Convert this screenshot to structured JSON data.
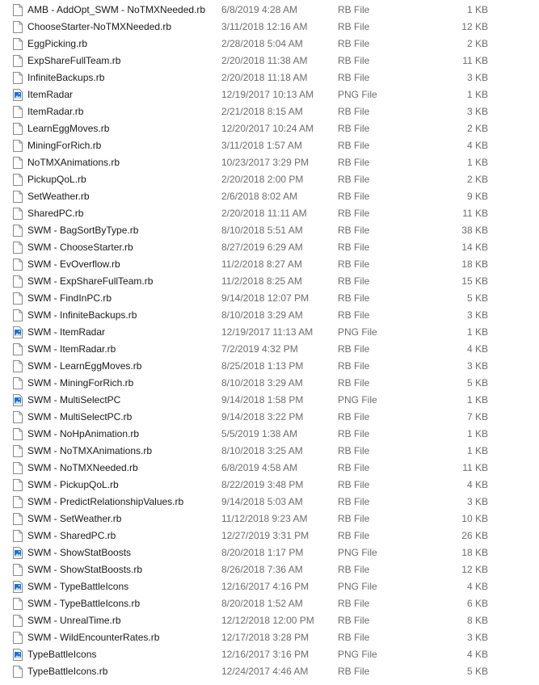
{
  "files": [
    {
      "name": "AMB - AddOpt_SWM - NoTMXNeeded.rb",
      "date": "6/8/2019 4:28 AM",
      "type": "RB File",
      "size": "1 KB",
      "icon": "document-icon"
    },
    {
      "name": "ChooseStarter-NoTMXNeeded.rb",
      "date": "3/11/2018 12:16 AM",
      "type": "RB File",
      "size": "12 KB",
      "icon": "document-icon"
    },
    {
      "name": "EggPicking.rb",
      "date": "2/28/2018 5:04 AM",
      "type": "RB File",
      "size": "2 KB",
      "icon": "document-icon"
    },
    {
      "name": "ExpShareFullTeam.rb",
      "date": "2/20/2018 11:38 AM",
      "type": "RB File",
      "size": "11 KB",
      "icon": "document-icon"
    },
    {
      "name": "InfiniteBackups.rb",
      "date": "2/20/2018 11:18 AM",
      "type": "RB File",
      "size": "3 KB",
      "icon": "document-icon"
    },
    {
      "name": "ItemRadar",
      "date": "12/19/2017 10:13 AM",
      "type": "PNG File",
      "size": "1 KB",
      "icon": "image-icon"
    },
    {
      "name": "ItemRadar.rb",
      "date": "2/21/2018 8:15 AM",
      "type": "RB File",
      "size": "3 KB",
      "icon": "document-icon"
    },
    {
      "name": "LearnEggMoves.rb",
      "date": "12/20/2017 10:24 AM",
      "type": "RB File",
      "size": "2 KB",
      "icon": "document-icon"
    },
    {
      "name": "MiningForRich.rb",
      "date": "3/11/2018 1:57 AM",
      "type": "RB File",
      "size": "4 KB",
      "icon": "document-icon"
    },
    {
      "name": "NoTMXAnimations.rb",
      "date": "10/23/2017 3:29 PM",
      "type": "RB File",
      "size": "1 KB",
      "icon": "document-icon"
    },
    {
      "name": "PickupQoL.rb",
      "date": "2/20/2018 2:00 PM",
      "type": "RB File",
      "size": "2 KB",
      "icon": "document-icon"
    },
    {
      "name": "SetWeather.rb",
      "date": "2/6/2018 8:02 AM",
      "type": "RB File",
      "size": "9 KB",
      "icon": "document-icon"
    },
    {
      "name": "SharedPC.rb",
      "date": "2/20/2018 11:11 AM",
      "type": "RB File",
      "size": "11 KB",
      "icon": "document-icon"
    },
    {
      "name": "SWM - BagSortByType.rb",
      "date": "8/10/2018 5:51 AM",
      "type": "RB File",
      "size": "38 KB",
      "icon": "document-icon"
    },
    {
      "name": "SWM - ChooseStarter.rb",
      "date": "8/27/2019 6:29 AM",
      "type": "RB File",
      "size": "14 KB",
      "icon": "document-icon"
    },
    {
      "name": "SWM - EvOverflow.rb",
      "date": "11/2/2018 8:27 AM",
      "type": "RB File",
      "size": "18 KB",
      "icon": "document-icon"
    },
    {
      "name": "SWM - ExpShareFullTeam.rb",
      "date": "11/2/2018 8:25 AM",
      "type": "RB File",
      "size": "15 KB",
      "icon": "document-icon"
    },
    {
      "name": "SWM - FindInPC.rb",
      "date": "9/14/2018 12:07 PM",
      "type": "RB File",
      "size": "5 KB",
      "icon": "document-icon"
    },
    {
      "name": "SWM - InfiniteBackups.rb",
      "date": "8/10/2018 3:29 AM",
      "type": "RB File",
      "size": "3 KB",
      "icon": "document-icon"
    },
    {
      "name": "SWM - ItemRadar",
      "date": "12/19/2017 11:13 AM",
      "type": "PNG File",
      "size": "1 KB",
      "icon": "image-icon"
    },
    {
      "name": "SWM - ItemRadar.rb",
      "date": "7/2/2019 4:32 PM",
      "type": "RB File",
      "size": "4 KB",
      "icon": "document-icon"
    },
    {
      "name": "SWM - LearnEggMoves.rb",
      "date": "8/25/2018 1:13 PM",
      "type": "RB File",
      "size": "3 KB",
      "icon": "document-icon"
    },
    {
      "name": "SWM - MiningForRich.rb",
      "date": "8/10/2018 3:29 AM",
      "type": "RB File",
      "size": "5 KB",
      "icon": "document-icon"
    },
    {
      "name": "SWM - MultiSelectPC",
      "date": "9/14/2018 1:58 PM",
      "type": "PNG File",
      "size": "1 KB",
      "icon": "image-icon"
    },
    {
      "name": "SWM - MultiSelectPC.rb",
      "date": "9/14/2018 3:22 PM",
      "type": "RB File",
      "size": "7 KB",
      "icon": "document-icon"
    },
    {
      "name": "SWM - NoHpAnimation.rb",
      "date": "5/5/2019 1:38 AM",
      "type": "RB File",
      "size": "1 KB",
      "icon": "document-icon"
    },
    {
      "name": "SWM - NoTMXAnimations.rb",
      "date": "8/10/2018 3:25 AM",
      "type": "RB File",
      "size": "1 KB",
      "icon": "document-icon"
    },
    {
      "name": "SWM - NoTMXNeeded.rb",
      "date": "6/8/2019 4:58 AM",
      "type": "RB File",
      "size": "11 KB",
      "icon": "document-icon"
    },
    {
      "name": "SWM - PickupQoL.rb",
      "date": "8/22/2019 3:48 PM",
      "type": "RB File",
      "size": "4 KB",
      "icon": "document-icon"
    },
    {
      "name": "SWM - PredictRelationshipValues.rb",
      "date": "9/14/2018 5:03 AM",
      "type": "RB File",
      "size": "3 KB",
      "icon": "document-icon"
    },
    {
      "name": "SWM - SetWeather.rb",
      "date": "11/12/2018 9:23 AM",
      "type": "RB File",
      "size": "10 KB",
      "icon": "document-icon"
    },
    {
      "name": "SWM - SharedPC.rb",
      "date": "12/27/2019 3:31 PM",
      "type": "RB File",
      "size": "26 KB",
      "icon": "document-icon"
    },
    {
      "name": "SWM - ShowStatBoosts",
      "date": "8/20/2018 1:17 PM",
      "type": "PNG File",
      "size": "18 KB",
      "icon": "image-icon"
    },
    {
      "name": "SWM - ShowStatBoosts.rb",
      "date": "8/26/2018 7:36 AM",
      "type": "RB File",
      "size": "12 KB",
      "icon": "document-icon"
    },
    {
      "name": "SWM - TypeBattleIcons",
      "date": "12/16/2017 4:16 PM",
      "type": "PNG File",
      "size": "4 KB",
      "icon": "image-icon"
    },
    {
      "name": "SWM - TypeBattleIcons.rb",
      "date": "8/20/2018 1:52 AM",
      "type": "RB File",
      "size": "6 KB",
      "icon": "document-icon"
    },
    {
      "name": "SWM - UnrealTime.rb",
      "date": "12/12/2018 12:00 PM",
      "type": "RB File",
      "size": "8 KB",
      "icon": "document-icon"
    },
    {
      "name": "SWM - WildEncounterRates.rb",
      "date": "12/17/2018 3:28 PM",
      "type": "RB File",
      "size": "3 KB",
      "icon": "document-icon"
    },
    {
      "name": "TypeBattleIcons",
      "date": "12/16/2017 3:16 PM",
      "type": "PNG File",
      "size": "4 KB",
      "icon": "image-icon"
    },
    {
      "name": "TypeBattleIcons.rb",
      "date": "12/24/2017 4:46 AM",
      "type": "RB File",
      "size": "5 KB",
      "icon": "document-icon"
    }
  ],
  "colors": {
    "name_text": "#1a1a1a",
    "meta_text": "#6d6d6d",
    "image_icon": "#1e6fd0"
  }
}
